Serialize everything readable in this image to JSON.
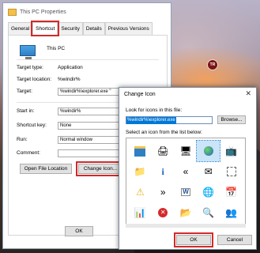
{
  "props_window": {
    "title": "This PC Properties",
    "tabs": [
      "General",
      "Shortcut",
      "Security",
      "Details",
      "Previous Versions"
    ],
    "active_tab": "Shortcut",
    "name": "This PC",
    "fields": {
      "target_type_label": "Target type:",
      "target_type_value": "Application",
      "target_location_label": "Target location:",
      "target_location_value": "%windir%",
      "target_label": "Target:",
      "target_value": "%windir%\\explorer.exe \"",
      "start_in_label": "Start in:",
      "start_in_value": "%windir%",
      "shortcut_key_label": "Shortcut key:",
      "shortcut_key_value": "None",
      "run_label": "Run:",
      "run_value": "Normal window",
      "comment_label": "Comment:",
      "comment_value": ""
    },
    "buttons": {
      "open_file_location": "Open File Location",
      "change_icon": "Change Icon...",
      "ok": "OK"
    }
  },
  "change_icon_dialog": {
    "title": "Change Icon",
    "look_for_label": "Look for icons in this file:",
    "path_value": "%windir%\\explorer.exe",
    "browse_label": "Browse...",
    "select_label": "Select an icon from the list below:",
    "icons": [
      "explorer-window-icon",
      "printer-icon",
      "monitor-icon",
      "globe-icon",
      "media-player-icon",
      "folder-arrow-icon",
      "info-icon",
      "double-arrow-icon",
      "mail-icon",
      "dashed-box-icon",
      "warning-icon",
      "chevron-right-icon",
      "document-w-icon",
      "globe-network-icon",
      "calendar-icon",
      "chart-icon",
      "close-red-icon",
      "folders-icon",
      "folder-search-icon",
      "users-icon"
    ],
    "selected_icon_index": 3,
    "ok_label": "OK",
    "cancel_label": "Cancel"
  },
  "desktop": {
    "badge_text": "TR"
  },
  "colors": {
    "highlight": "#d22a2a",
    "selection": "#0078d7"
  }
}
